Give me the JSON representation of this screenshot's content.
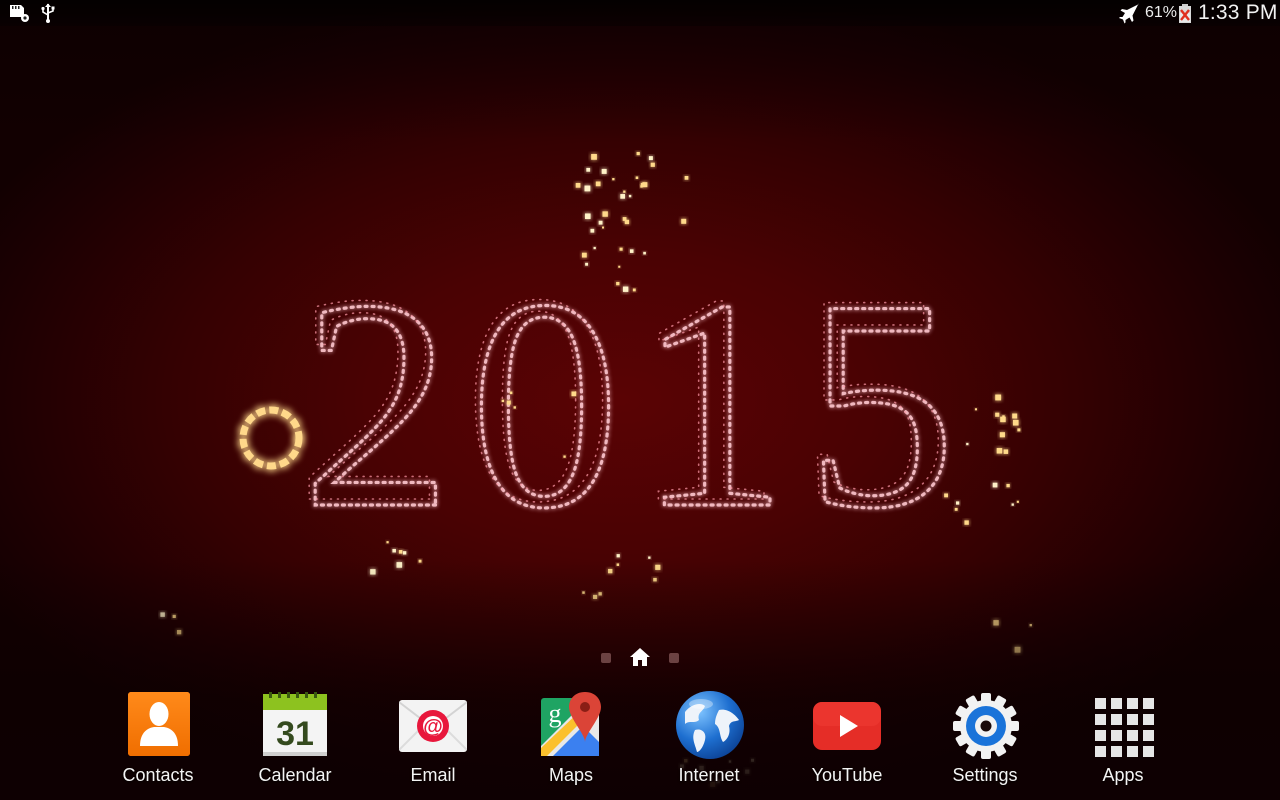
{
  "status_bar": {
    "left_icons": [
      "sd-card-settings-icon",
      "usb-icon"
    ],
    "right_icons": [
      "airplane-mode-icon",
      "battery-icon"
    ],
    "battery_percent": "61%",
    "time": "1:33 PM"
  },
  "wallpaper": {
    "headline_text": "2015",
    "theme": "new-year-fireworks",
    "colors": {
      "background_center": "#5a0304",
      "background_edge": "#120001",
      "sparkle_pink": "#ffd0d8",
      "sparkle_gold": "#ffd98a"
    }
  },
  "page_indicator": {
    "pages": [
      "page-1",
      "home",
      "page-3"
    ],
    "current": "home"
  },
  "dock": {
    "items": [
      {
        "label": "Contacts",
        "icon": "contacts-icon",
        "color": "#ff7a00"
      },
      {
        "label": "Calendar",
        "icon": "calendar-icon",
        "date": "31",
        "color": "#8dc21f"
      },
      {
        "label": "Email",
        "icon": "email-icon",
        "symbol": "@",
        "color": "#e8173c"
      },
      {
        "label": "Maps",
        "icon": "maps-icon",
        "symbol": "g",
        "color": "#db4437"
      },
      {
        "label": "Internet",
        "icon": "internet-globe-icon",
        "color": "#1e6fd0"
      },
      {
        "label": "YouTube",
        "icon": "youtube-icon",
        "color": "#e52d27"
      },
      {
        "label": "Settings",
        "icon": "settings-gear-icon",
        "color": "#1a73d9"
      },
      {
        "label": "Apps",
        "icon": "apps-grid-icon",
        "color": "#e6e6e6"
      }
    ]
  }
}
